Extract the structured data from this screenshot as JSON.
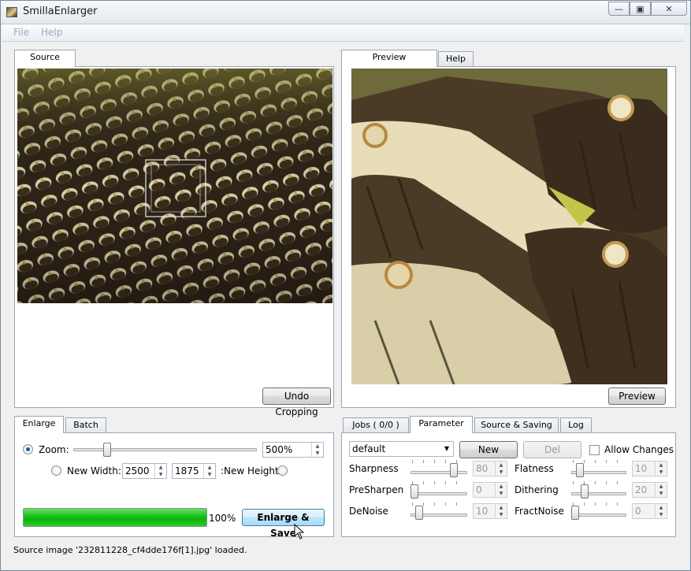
{
  "app": {
    "title": "SmillaEnlarger"
  },
  "window_controls": {
    "minimize": "—",
    "maximize": "▣",
    "close": "✕"
  },
  "menu": [
    "File",
    "Help"
  ],
  "source_panel": {
    "tab": "Source",
    "undo_cropping_label": "Undo Cropping"
  },
  "preview_panel": {
    "tabs": [
      "Preview",
      "Help"
    ],
    "preview_button_label": "Preview"
  },
  "enlarge_panel": {
    "tabs": [
      "Enlarge",
      "Batch"
    ],
    "zoom_label": "Zoom:",
    "zoom_value": "500%",
    "zoom_fraction": 0.17,
    "new_width_label": "New Width:",
    "width_value": "2500",
    "height_value": "1875",
    "new_height_label": ":New Height",
    "progress_text": "100%",
    "progress_fraction": 1.0,
    "enlarge_save_label": "Enlarge & Save"
  },
  "param_panel": {
    "tabs": [
      "Jobs ( 0/0 )",
      "Parameter",
      "Source & Saving",
      "Log"
    ],
    "preset": "default",
    "new_label": "New",
    "del_label": "Del",
    "allow_changes_label": "Allow Changes",
    "params": [
      {
        "name": "Sharpness",
        "value": "80",
        "fraction": 0.8
      },
      {
        "name": "Flatness",
        "value": "10",
        "fraction": 0.1
      },
      {
        "name": "PreSharpen",
        "value": "0",
        "fraction": 0.0
      },
      {
        "name": "Dithering",
        "value": "20",
        "fraction": 0.2
      },
      {
        "name": "DeNoise",
        "value": "10",
        "fraction": 0.1
      },
      {
        "name": "FractNoise",
        "value": "0",
        "fraction": 0.0
      }
    ]
  },
  "status": "Source image '232811228_cf4dde176f[1].jpg' loaded.",
  "colors": {
    "progress": "#1fc41f",
    "accent": "#1b5aa8"
  }
}
